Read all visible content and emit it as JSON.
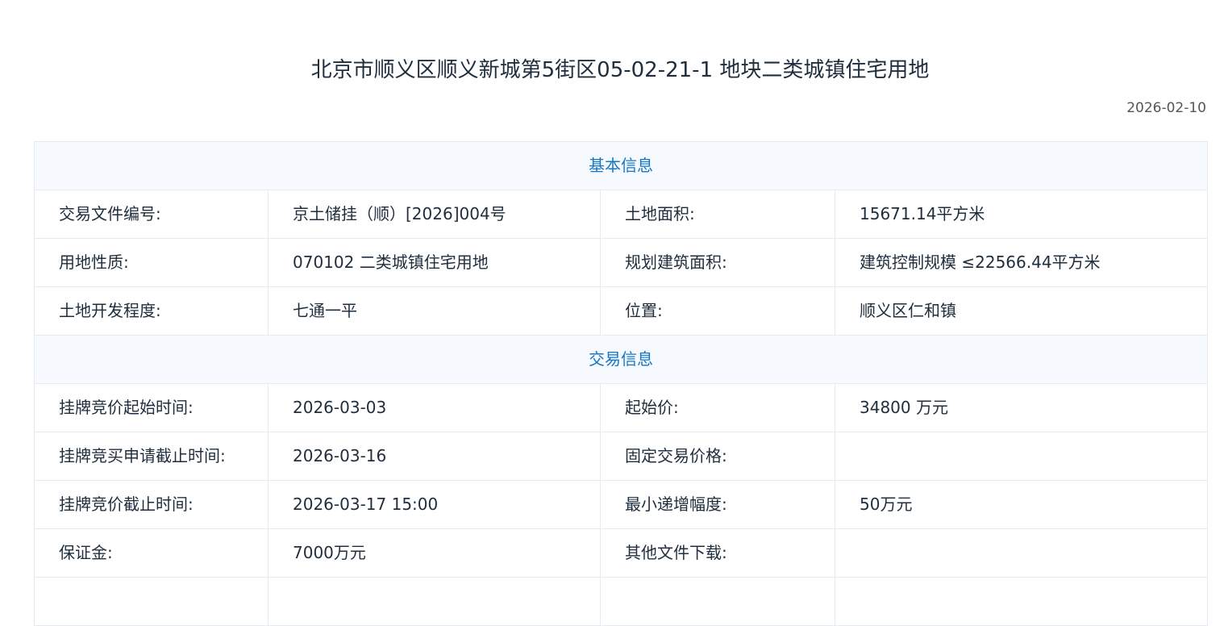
{
  "title": "北京市顺义区顺义新城第5街区05-02-21-1 地块二类城镇住宅用地",
  "date": "2026-02-10",
  "sections": {
    "basic": {
      "header": "基本信息",
      "rows": [
        {
          "label1": "交易文件编号:",
          "value1": "京土储挂（顺）[2026]004号",
          "label2": "土地面积:",
          "value2": "15671.14平方米"
        },
        {
          "label1": "用地性质:",
          "value1": "070102 二类城镇住宅用地",
          "label2": "规划建筑面积:",
          "value2": "建筑控制规模 ≤22566.44平方米"
        },
        {
          "label1": "土地开发程度:",
          "value1": "七通一平",
          "label2": "位置:",
          "value2": "顺义区仁和镇"
        }
      ]
    },
    "trade": {
      "header": "交易信息",
      "rows": [
        {
          "label1": "挂牌竞价起始时间:",
          "value1": "2026-03-03",
          "label2": "起始价:",
          "value2": "34800 万元"
        },
        {
          "label1": "挂牌竞买申请截止时间:",
          "value1": "2026-03-16",
          "label2": "固定交易价格:",
          "value2": ""
        },
        {
          "label1": "挂牌竞价截止时间:",
          "value1": "2026-03-17 15:00",
          "label2": "最小递增幅度:",
          "value2": "50万元"
        },
        {
          "label1": "保证金:",
          "value1": "7000万元",
          "label2": "其他文件下载:",
          "value2": ""
        }
      ]
    }
  }
}
